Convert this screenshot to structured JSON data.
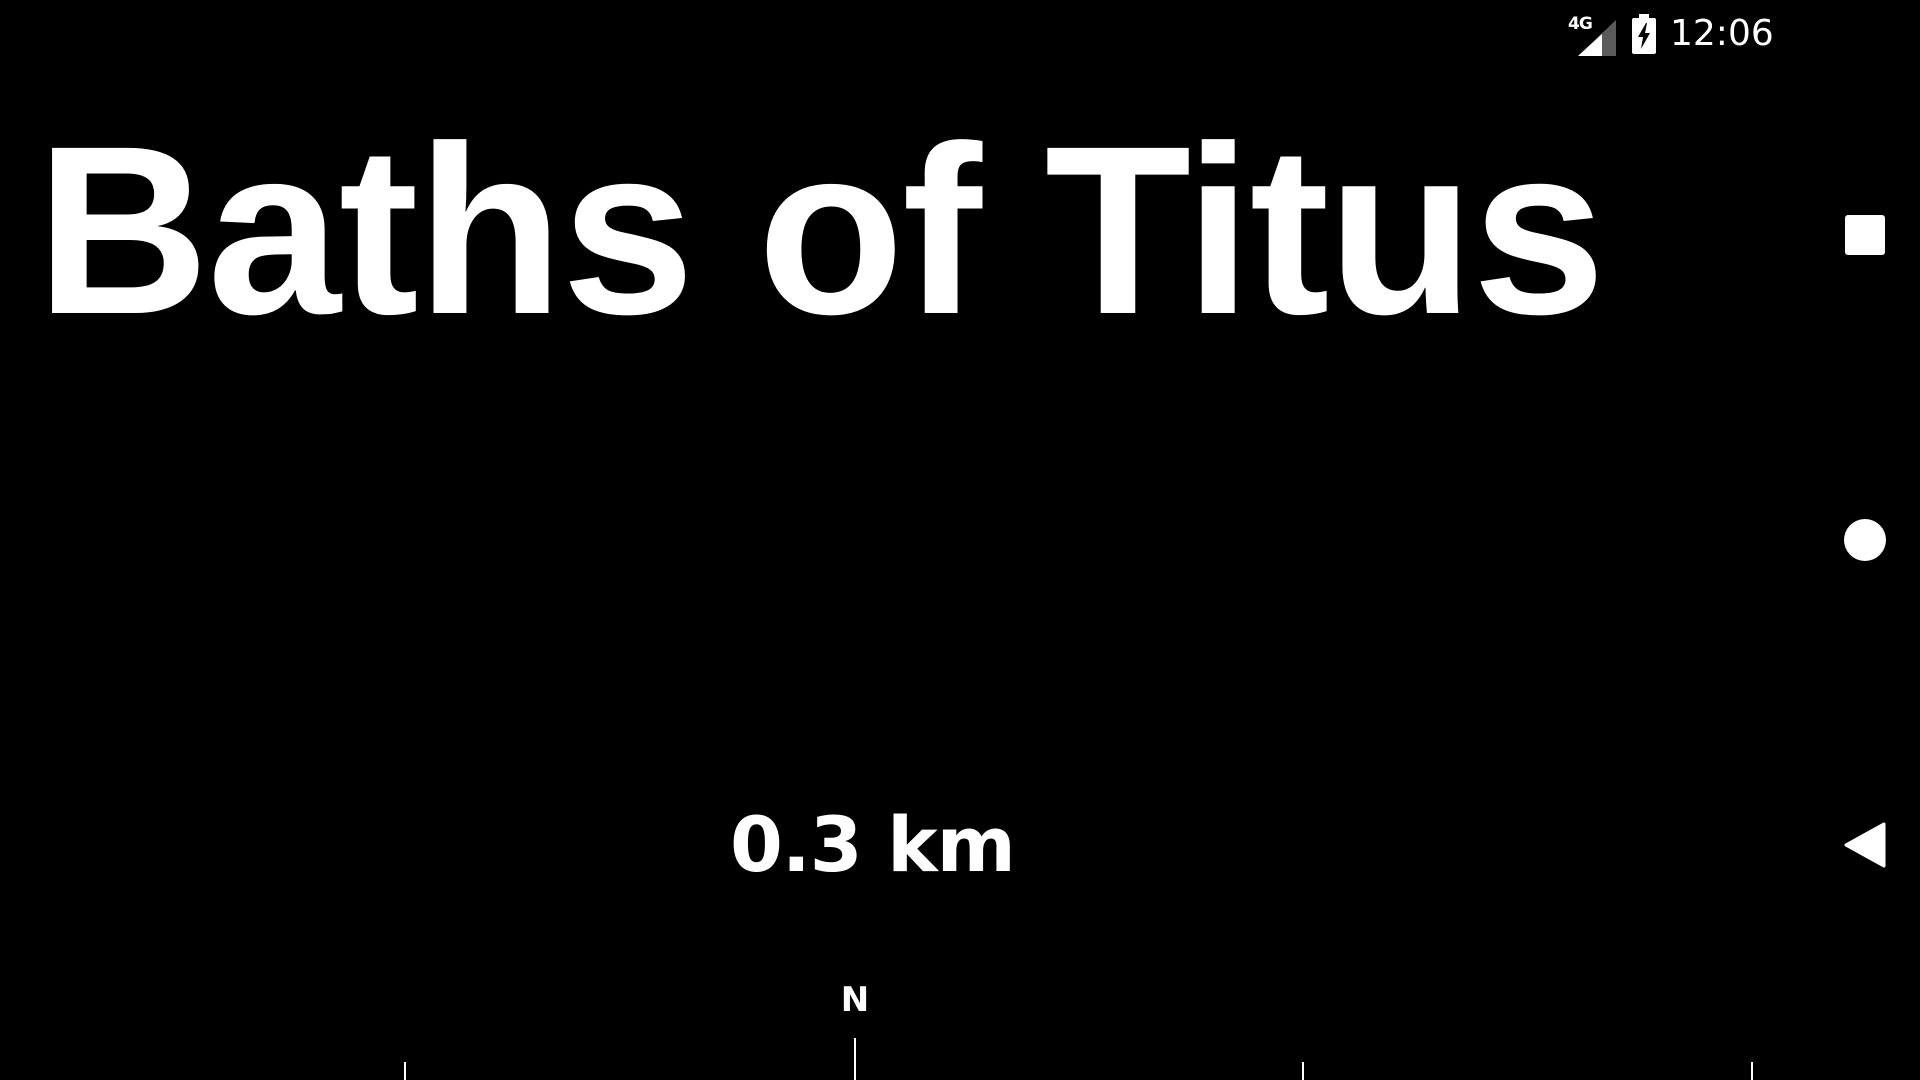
{
  "status_bar": {
    "network_type": "4G",
    "time": "12:06",
    "icons": [
      "signal-icon",
      "battery-charging-icon"
    ]
  },
  "place": {
    "title": "Baths of Titus",
    "distance": "0.3 km"
  },
  "compass": {
    "north_label": "N"
  },
  "nav_bar": {
    "icons": [
      "recents-icon",
      "home-icon",
      "back-icon"
    ]
  },
  "colors": {
    "background": "#000000",
    "foreground": "#ffffff"
  }
}
